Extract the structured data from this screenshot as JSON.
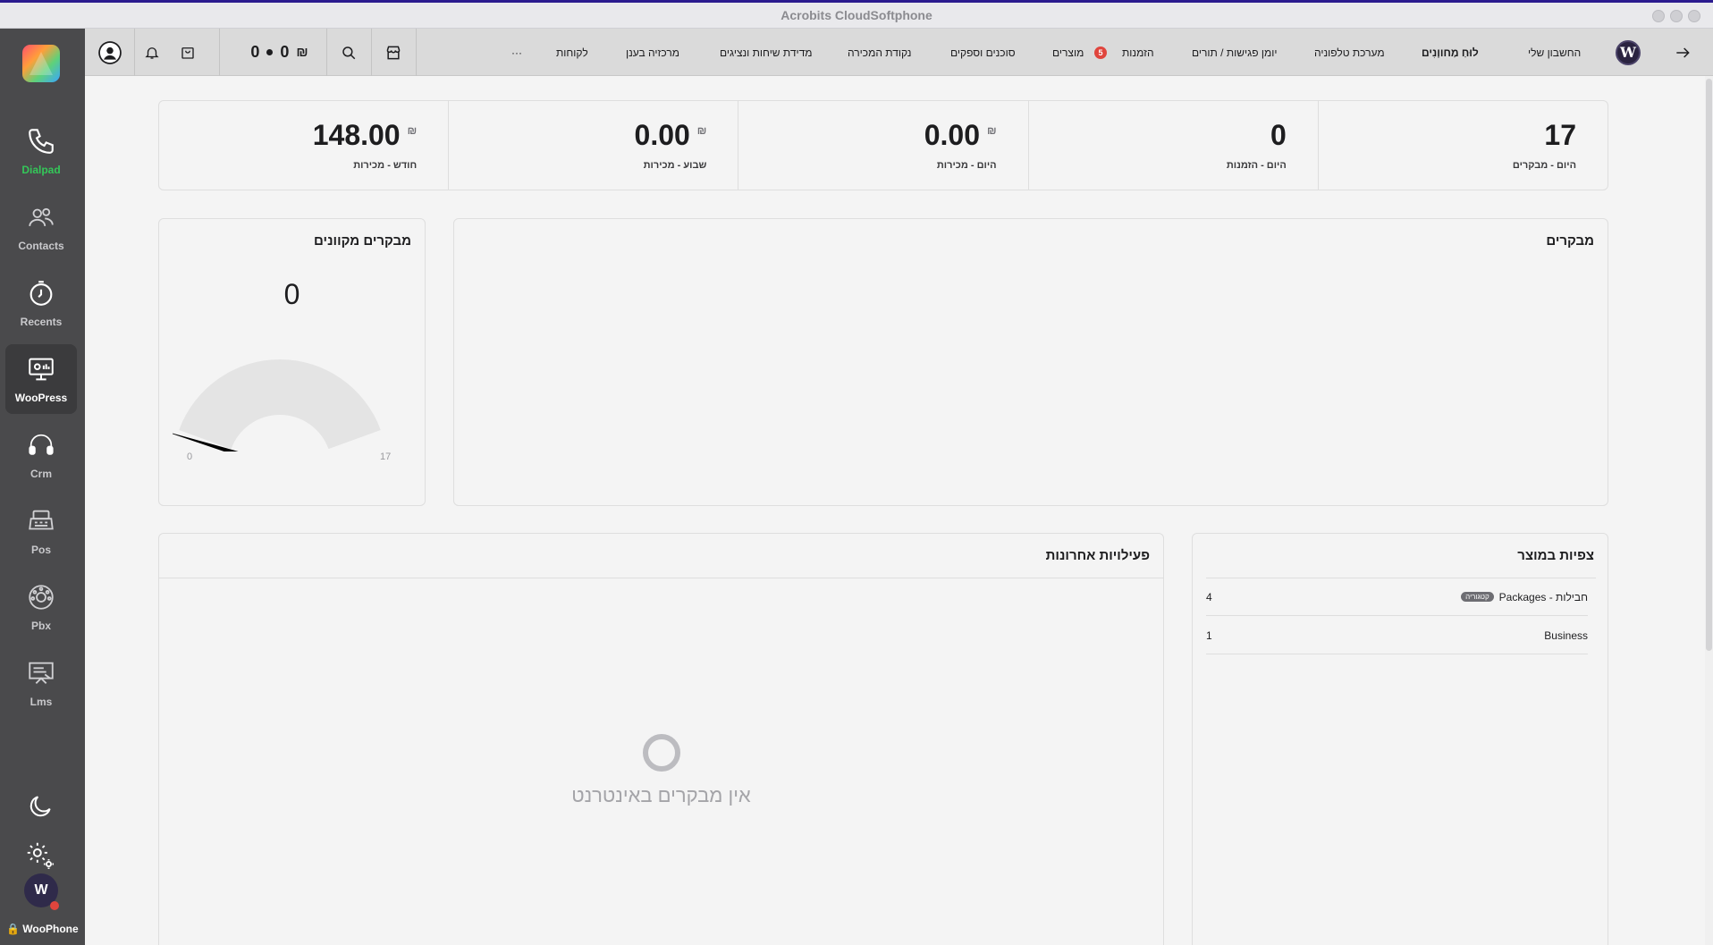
{
  "window": {
    "title": "Acrobits CloudSoftphone"
  },
  "sidebar": {
    "items": [
      {
        "label": "Dialpad",
        "icon": "phone-icon"
      },
      {
        "label": "Contacts",
        "icon": "contacts-icon"
      },
      {
        "label": "Recents",
        "icon": "clock-icon"
      },
      {
        "label": "WooPress",
        "icon": "monitor-icon"
      },
      {
        "label": "Crm",
        "icon": "headset-icon"
      },
      {
        "label": "Pos",
        "icon": "register-icon"
      },
      {
        "label": "Pbx",
        "icon": "rotary-phone-icon"
      },
      {
        "label": "Lms",
        "icon": "presentation-icon"
      }
    ],
    "active": "WooPress",
    "account_label": "WooPhone",
    "avatar_text": "W"
  },
  "topnav": {
    "counter": {
      "left": "0",
      "right": "0",
      "currency": "₪"
    },
    "links": {
      "my_account": "החשבון שלי",
      "dashboard": "לוּחַ מַחווָנִים",
      "phone_system": "מערכת טלפוניה",
      "calendar": "יומן פגישות / תורים",
      "orders": "הזמנות",
      "orders_badge": "5",
      "products": "מוצרים",
      "agents": "סוכנים וספקים",
      "pos": "נקודת המכירה",
      "calls": "מדידת שיחות ונציגים",
      "cloud_center": "מרכזיה בענן",
      "customers": "לקוחות",
      "more": "···"
    }
  },
  "stats": [
    {
      "value": "148.00",
      "currency": "₪",
      "label": "חודש - מכירות"
    },
    {
      "value": "0.00",
      "currency": "₪",
      "label": "שבוע - מכירות"
    },
    {
      "value": "0.00",
      "currency": "₪",
      "label": "היום - מכירות"
    },
    {
      "value": "0",
      "currency": "",
      "label": "היום - הזמנות"
    },
    {
      "value": "17",
      "currency": "",
      "label": "היום - מבקרים"
    }
  ],
  "online_visitors": {
    "title": "מבקרים מקוונים",
    "value": "0",
    "min": "0",
    "max": "17",
    "level": 0
  },
  "visitors": {
    "title": "מבקרים"
  },
  "recent_activity": {
    "title": "פעילויות אחרונות",
    "empty_text": "אין מבקרים באינטרנט"
  },
  "product_views": {
    "title": "צפיות במוצר",
    "rows": [
      {
        "name": "חבילות - Packages",
        "tag": "קטגוריה",
        "count": "4"
      },
      {
        "name": "Business",
        "tag": "",
        "count": "1"
      }
    ]
  }
}
